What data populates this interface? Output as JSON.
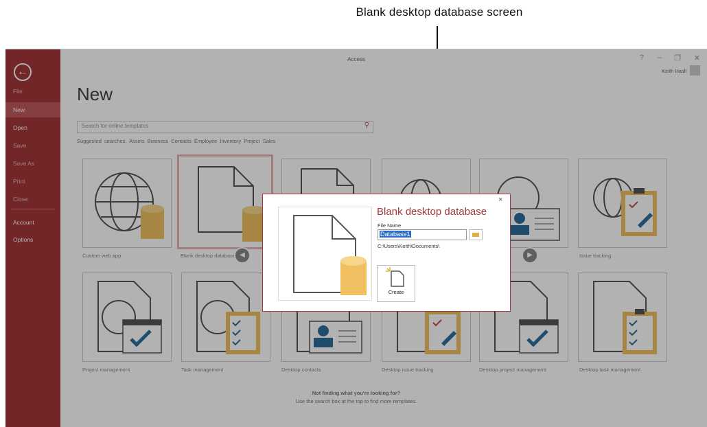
{
  "callout": {
    "text": "Blank  desktop database screen"
  },
  "window": {
    "title": "Access",
    "controls": [
      "?",
      "–",
      "❐",
      "✕"
    ],
    "user": "Keith Hasll",
    "back_icon": "back-arrow-icon"
  },
  "backstage": {
    "items": [
      {
        "label": "File",
        "state": "dim"
      },
      {
        "label": "New",
        "state": "selected"
      },
      {
        "label": "Open",
        "state": "normal"
      },
      {
        "label": "Save",
        "state": "dim"
      },
      {
        "label": "Save As",
        "state": "dim"
      },
      {
        "label": "Print",
        "state": "dim"
      },
      {
        "label": "Close",
        "state": "dim"
      },
      {
        "label": "Account",
        "state": "normal"
      },
      {
        "label": "Options",
        "state": "normal"
      }
    ]
  },
  "main": {
    "heading": "New",
    "search_placeholder": "Search for online templates",
    "suggested": "Suggested searches:  Assets   Business   Contacts   Employee   Inventory   Project   Sales",
    "templates": [
      {
        "label": "Custom web app"
      },
      {
        "label": "Blank desktop database"
      },
      {
        "label": ""
      },
      {
        "label": ""
      },
      {
        "label": ""
      },
      {
        "label": "Issue tracking"
      },
      {
        "label": "Project management"
      },
      {
        "label": "Task management"
      },
      {
        "label": "Desktop contacts"
      },
      {
        "label": "Desktop issue tracking"
      },
      {
        "label": "Desktop project management"
      },
      {
        "label": "Desktop task management"
      }
    ],
    "not_finding_title": "Not finding what you're looking for?",
    "not_finding_sub": "Use the search box at the top to find more templates."
  },
  "dialog": {
    "title": "Blank desktop database",
    "file_name_label": "File Name",
    "file_name_value": "Database1",
    "path": "C:\\Users\\Keith\\Documents\\",
    "create_label": "Create",
    "close": "×"
  },
  "colors": {
    "accent": "#a4373a",
    "tile_gold": "#f0c060",
    "tile_blue": "#2e6e9e"
  }
}
